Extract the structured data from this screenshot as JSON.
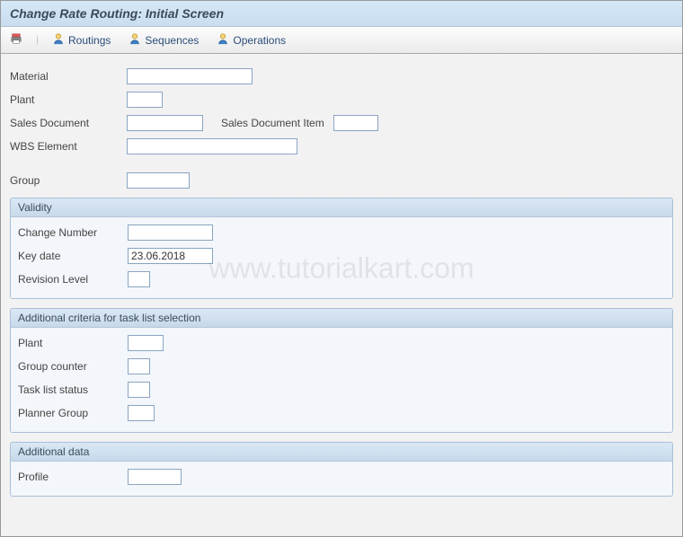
{
  "title": "Change Rate Routing: Initial Screen",
  "watermark": "www.tutorialkart.com",
  "toolbar": {
    "routings": "Routings",
    "sequences": "Sequences",
    "operations": "Operations"
  },
  "header": {
    "material_label": "Material",
    "material_value": "",
    "plant_label": "Plant",
    "plant_value": "",
    "salesdoc_label": "Sales Document",
    "salesdoc_value": "",
    "salesdocitem_label": "Sales Document Item",
    "salesdocitem_value": "",
    "wbs_label": "WBS Element",
    "wbs_value": "",
    "group_label": "Group",
    "group_value": ""
  },
  "validity": {
    "title": "Validity",
    "change_number_label": "Change Number",
    "change_number_value": "",
    "key_date_label": "Key date",
    "key_date_value": "23.06.2018",
    "revision_label": "Revision Level",
    "revision_value": ""
  },
  "criteria": {
    "title": "Additional criteria for task list selection",
    "plant_label": "Plant",
    "plant_value": "",
    "group_counter_label": "Group counter",
    "group_counter_value": "",
    "status_label": "Task list status",
    "status_value": "",
    "planner_label": "Planner Group",
    "planner_value": ""
  },
  "additional": {
    "title": "Additional data",
    "profile_label": "Profile",
    "profile_value": ""
  }
}
